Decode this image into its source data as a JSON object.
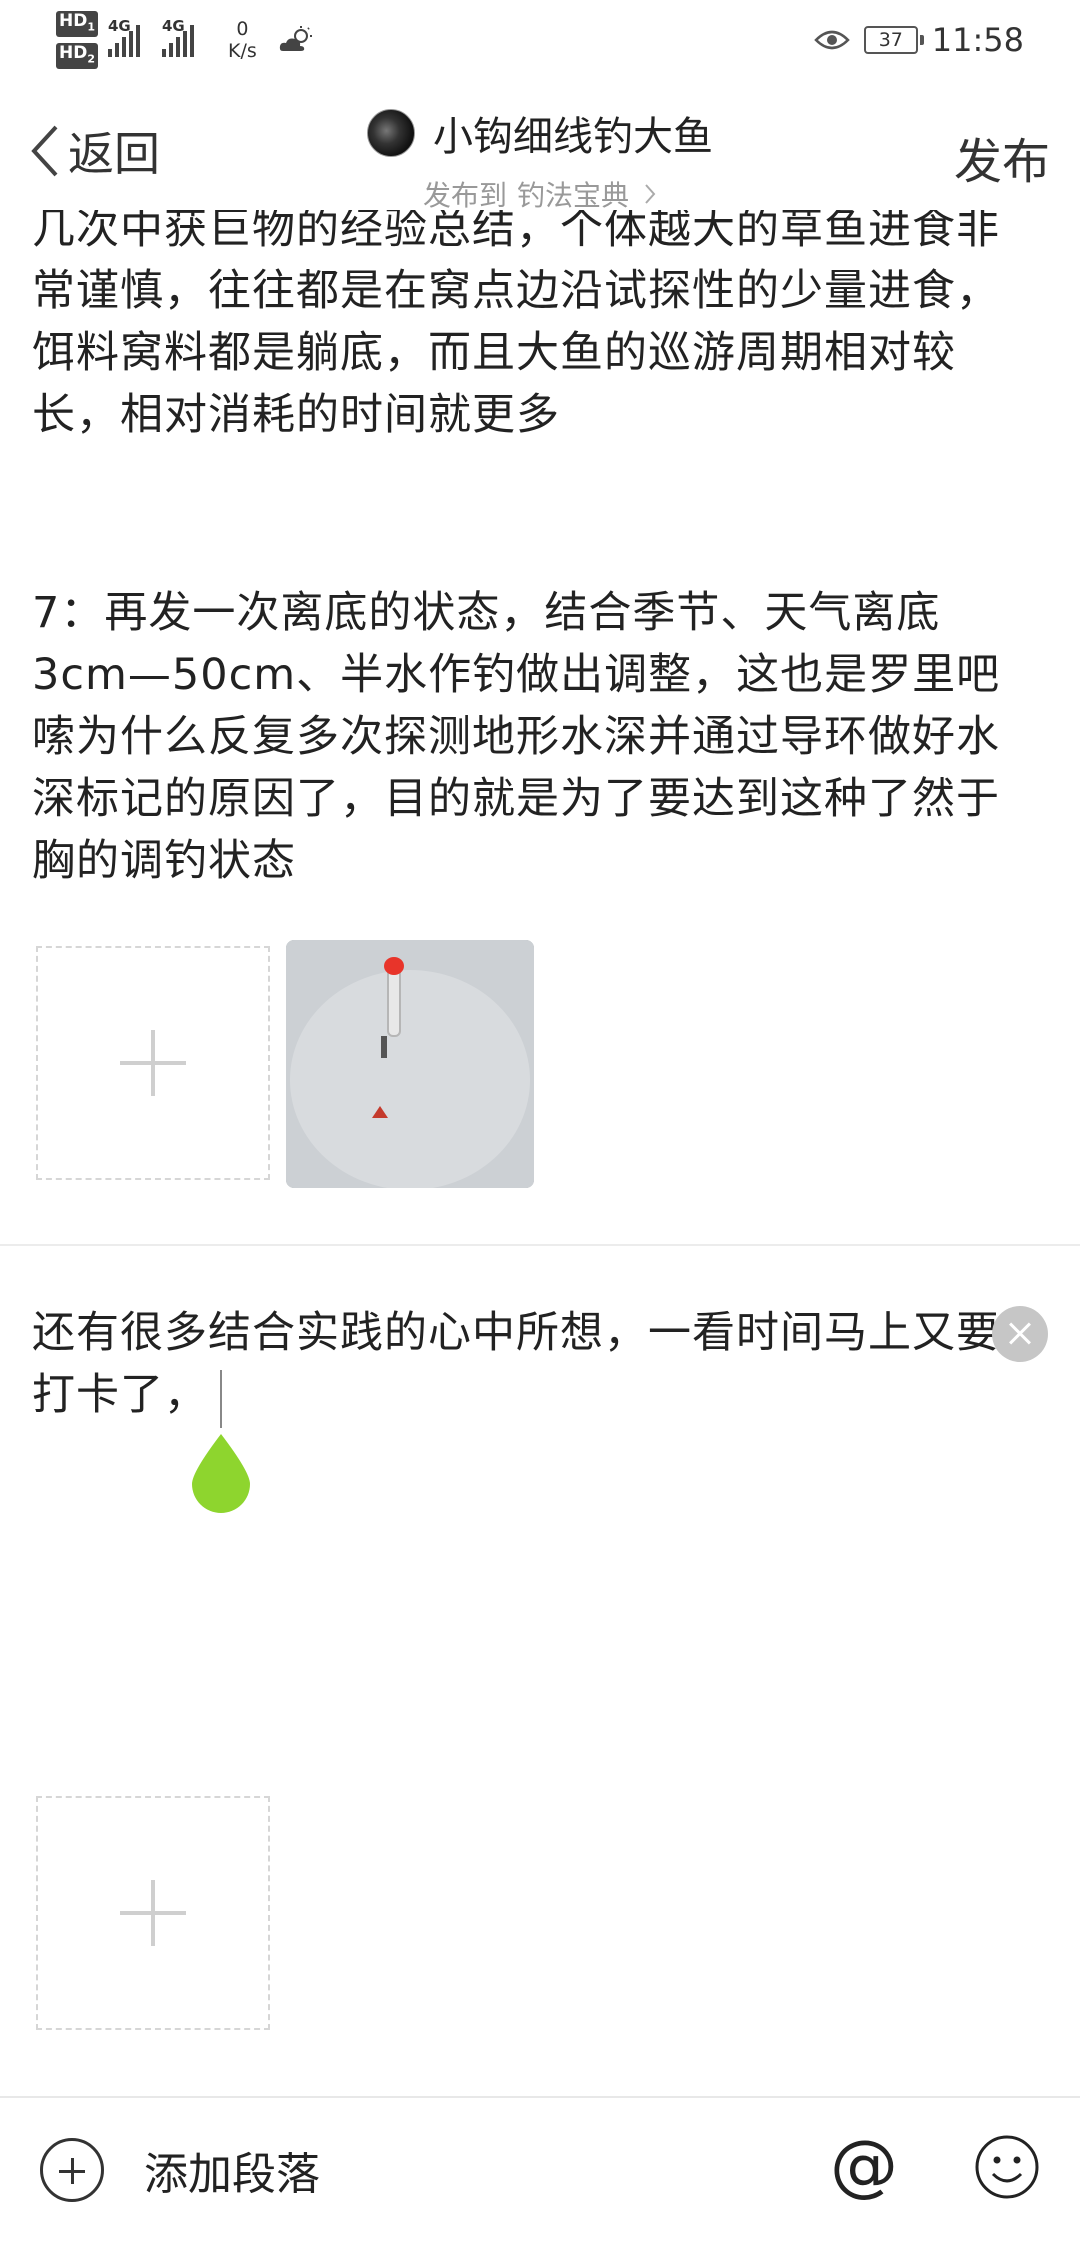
{
  "status_bar": {
    "hd1": "HD",
    "hd1_sub": "1",
    "hd2": "HD",
    "hd2_sub": "2",
    "net1": "4G",
    "net2": "4G",
    "speed_value": "0",
    "speed_unit": "K/s",
    "battery": "37",
    "time": "11:58"
  },
  "nav": {
    "back_label": "返回",
    "title": "小钩细线钓大鱼",
    "publish_to_prefix": "发布到",
    "publish_to_target": "钓法宝典",
    "publish_label": "发布"
  },
  "content": {
    "paragraph1": "几次中获巨物的经验总结，个体越大的草鱼进食非常谨慎，往往都是在窝点边沿试探性的少量进食，饵料窝料都是躺底，而且大鱼的巡游周期相对较长，相对消耗的时间就更多",
    "paragraph2": "7：再发一次离底的状态，结合季节、天气离底3cm—50cm、半水作钓做出调整，这也是罗里吧嗦为什么反复多次探测地形水深并通过导环做好水深标记的原因了，目的就是为了要达到这种了然于胸的调钓状态",
    "paragraph3": "还有很多结合实践的心中所想，一看时间马上又要打卡了，"
  },
  "toolbar": {
    "add_paragraph": "添加段落",
    "at_symbol": "@"
  },
  "icons": {
    "back": "chevron-left-icon",
    "add_image": "plus-icon",
    "close": "close-icon",
    "add_paragraph": "plus-circle-icon",
    "emoji": "smiley-icon"
  },
  "colors": {
    "cursor_handle": "#8ed52e",
    "placeholder_border": "#d6d6d6",
    "close_button": "#c6c6c6"
  }
}
